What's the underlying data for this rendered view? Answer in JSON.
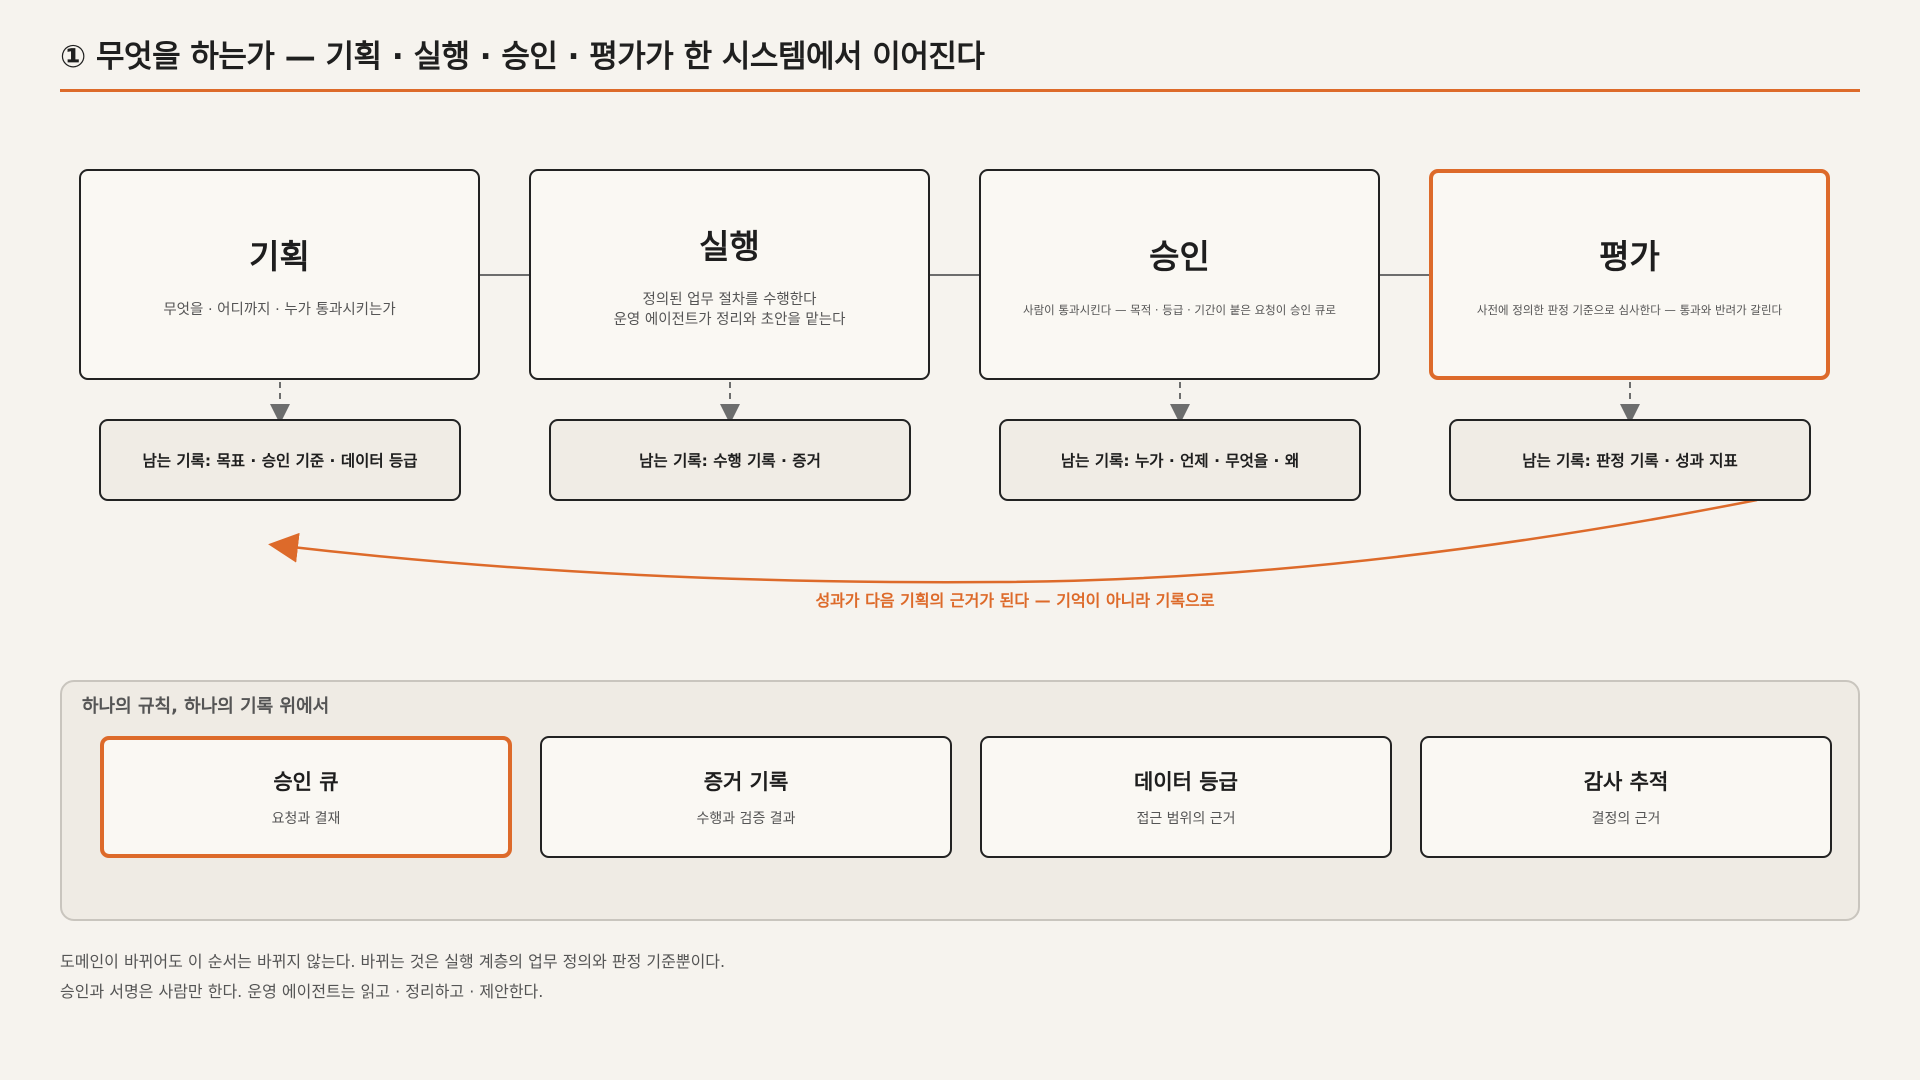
{
  "title": "① 무엇을 하는가 — 기획 · 실행 · 승인 · 평가가 한 시스템에서 이어진다",
  "colors": {
    "accent": "#dd6a2a",
    "border": "#222222",
    "background": "#f6f3ee",
    "record_fill": "#f0ece5",
    "platform_fill": "#efebe4"
  },
  "stages": [
    {
      "title": "기획",
      "desc": "무엇을 · 어디까지 · 누가 통과시키는가",
      "record": "남는 기록: 목표 · 승인 기준 · 데이터 등급",
      "highlight": false
    },
    {
      "title": "실행",
      "desc": "정의된 업무 절차를 수행한다\n운영 에이전트가 정리와 초안을 맡는다",
      "record": "남는 기록: 수행 기록 · 증거",
      "highlight": false
    },
    {
      "title": "승인",
      "desc": "사람이 통과시킨다 — 목적 · 등급 · 기간이 붙은 요청이 승인 큐로",
      "record": "남는 기록: 누가 · 언제 · 무엇을 · 왜",
      "highlight": false
    },
    {
      "title": "평가",
      "desc": "사전에 정의한 판정 기준으로 심사한다 — 통과와 반려가 갈린다",
      "record": "남는 기록: 판정 기록 · 성과 지표",
      "highlight": true
    }
  ],
  "feedback_label": "성과가 다음 기획의 근거가 된다 — 기억이 아니라 기록으로",
  "platform": {
    "title": "하나의 규칙, 하나의 기록 위에서",
    "modules": [
      {
        "title": "승인 큐",
        "sub": "요청과 결재",
        "highlight": true
      },
      {
        "title": "증거 기록",
        "sub": "수행과 검증 결과",
        "highlight": false
      },
      {
        "title": "데이터 등급",
        "sub": "접근 범위의 근거",
        "highlight": false
      },
      {
        "title": "감사 추적",
        "sub": "결정의 근거",
        "highlight": false
      }
    ]
  },
  "footnotes": [
    "도메인이 바뀌어도 이 순서는 바뀌지 않는다. 바뀌는 것은 실행 계층의 업무 정의와 판정 기준뿐이다.",
    "승인과 서명은 사람만 한다. 운영 에이전트는 읽고 · 정리하고 · 제안한다."
  ]
}
